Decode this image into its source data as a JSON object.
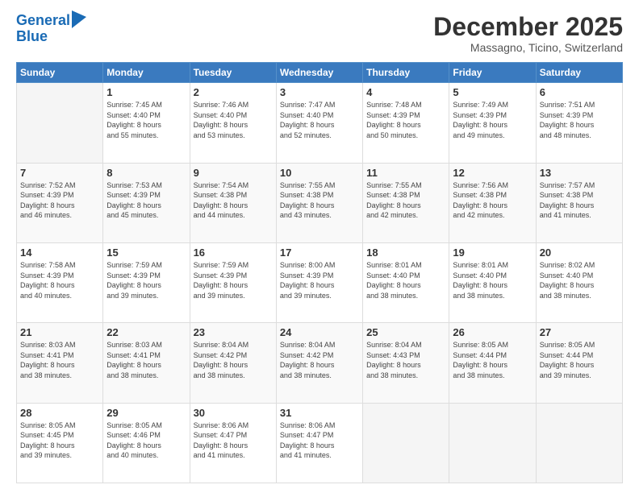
{
  "header": {
    "logo_line1": "General",
    "logo_line2": "Blue",
    "month_title": "December 2025",
    "location": "Massagno, Ticino, Switzerland"
  },
  "days_of_week": [
    "Sunday",
    "Monday",
    "Tuesday",
    "Wednesday",
    "Thursday",
    "Friday",
    "Saturday"
  ],
  "weeks": [
    [
      {
        "day": "",
        "content": ""
      },
      {
        "day": "1",
        "content": "Sunrise: 7:45 AM\nSunset: 4:40 PM\nDaylight: 8 hours\nand 55 minutes."
      },
      {
        "day": "2",
        "content": "Sunrise: 7:46 AM\nSunset: 4:40 PM\nDaylight: 8 hours\nand 53 minutes."
      },
      {
        "day": "3",
        "content": "Sunrise: 7:47 AM\nSunset: 4:40 PM\nDaylight: 8 hours\nand 52 minutes."
      },
      {
        "day": "4",
        "content": "Sunrise: 7:48 AM\nSunset: 4:39 PM\nDaylight: 8 hours\nand 50 minutes."
      },
      {
        "day": "5",
        "content": "Sunrise: 7:49 AM\nSunset: 4:39 PM\nDaylight: 8 hours\nand 49 minutes."
      },
      {
        "day": "6",
        "content": "Sunrise: 7:51 AM\nSunset: 4:39 PM\nDaylight: 8 hours\nand 48 minutes."
      }
    ],
    [
      {
        "day": "7",
        "content": "Sunrise: 7:52 AM\nSunset: 4:39 PM\nDaylight: 8 hours\nand 46 minutes."
      },
      {
        "day": "8",
        "content": "Sunrise: 7:53 AM\nSunset: 4:39 PM\nDaylight: 8 hours\nand 45 minutes."
      },
      {
        "day": "9",
        "content": "Sunrise: 7:54 AM\nSunset: 4:38 PM\nDaylight: 8 hours\nand 44 minutes."
      },
      {
        "day": "10",
        "content": "Sunrise: 7:55 AM\nSunset: 4:38 PM\nDaylight: 8 hours\nand 43 minutes."
      },
      {
        "day": "11",
        "content": "Sunrise: 7:55 AM\nSunset: 4:38 PM\nDaylight: 8 hours\nand 42 minutes."
      },
      {
        "day": "12",
        "content": "Sunrise: 7:56 AM\nSunset: 4:38 PM\nDaylight: 8 hours\nand 42 minutes."
      },
      {
        "day": "13",
        "content": "Sunrise: 7:57 AM\nSunset: 4:38 PM\nDaylight: 8 hours\nand 41 minutes."
      }
    ],
    [
      {
        "day": "14",
        "content": "Sunrise: 7:58 AM\nSunset: 4:39 PM\nDaylight: 8 hours\nand 40 minutes."
      },
      {
        "day": "15",
        "content": "Sunrise: 7:59 AM\nSunset: 4:39 PM\nDaylight: 8 hours\nand 39 minutes."
      },
      {
        "day": "16",
        "content": "Sunrise: 7:59 AM\nSunset: 4:39 PM\nDaylight: 8 hours\nand 39 minutes."
      },
      {
        "day": "17",
        "content": "Sunrise: 8:00 AM\nSunset: 4:39 PM\nDaylight: 8 hours\nand 39 minutes."
      },
      {
        "day": "18",
        "content": "Sunrise: 8:01 AM\nSunset: 4:40 PM\nDaylight: 8 hours\nand 38 minutes."
      },
      {
        "day": "19",
        "content": "Sunrise: 8:01 AM\nSunset: 4:40 PM\nDaylight: 8 hours\nand 38 minutes."
      },
      {
        "day": "20",
        "content": "Sunrise: 8:02 AM\nSunset: 4:40 PM\nDaylight: 8 hours\nand 38 minutes."
      }
    ],
    [
      {
        "day": "21",
        "content": "Sunrise: 8:03 AM\nSunset: 4:41 PM\nDaylight: 8 hours\nand 38 minutes."
      },
      {
        "day": "22",
        "content": "Sunrise: 8:03 AM\nSunset: 4:41 PM\nDaylight: 8 hours\nand 38 minutes."
      },
      {
        "day": "23",
        "content": "Sunrise: 8:04 AM\nSunset: 4:42 PM\nDaylight: 8 hours\nand 38 minutes."
      },
      {
        "day": "24",
        "content": "Sunrise: 8:04 AM\nSunset: 4:42 PM\nDaylight: 8 hours\nand 38 minutes."
      },
      {
        "day": "25",
        "content": "Sunrise: 8:04 AM\nSunset: 4:43 PM\nDaylight: 8 hours\nand 38 minutes."
      },
      {
        "day": "26",
        "content": "Sunrise: 8:05 AM\nSunset: 4:44 PM\nDaylight: 8 hours\nand 38 minutes."
      },
      {
        "day": "27",
        "content": "Sunrise: 8:05 AM\nSunset: 4:44 PM\nDaylight: 8 hours\nand 39 minutes."
      }
    ],
    [
      {
        "day": "28",
        "content": "Sunrise: 8:05 AM\nSunset: 4:45 PM\nDaylight: 8 hours\nand 39 minutes."
      },
      {
        "day": "29",
        "content": "Sunrise: 8:05 AM\nSunset: 4:46 PM\nDaylight: 8 hours\nand 40 minutes."
      },
      {
        "day": "30",
        "content": "Sunrise: 8:06 AM\nSunset: 4:47 PM\nDaylight: 8 hours\nand 41 minutes."
      },
      {
        "day": "31",
        "content": "Sunrise: 8:06 AM\nSunset: 4:47 PM\nDaylight: 8 hours\nand 41 minutes."
      },
      {
        "day": "",
        "content": ""
      },
      {
        "day": "",
        "content": ""
      },
      {
        "day": "",
        "content": ""
      }
    ]
  ]
}
